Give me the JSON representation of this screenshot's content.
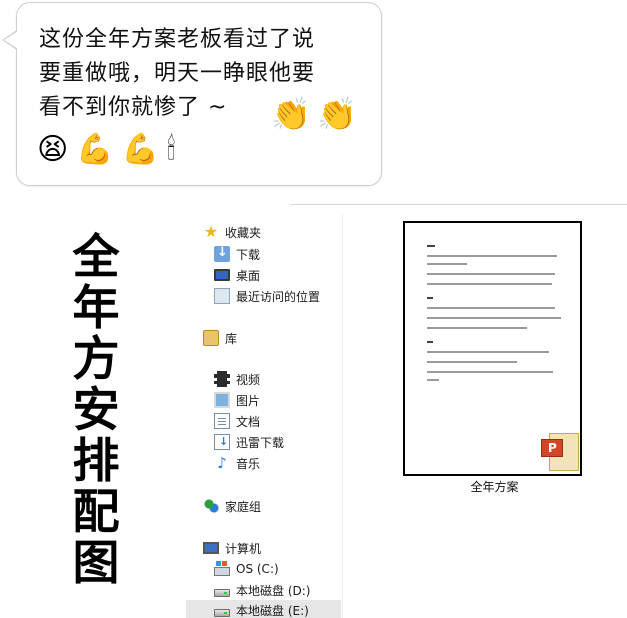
{
  "chat": {
    "line1": "这份全年方案老板看过了说",
    "line2": "要重做哦，明天一睁眼他要",
    "line3": "看不到你就惨了 ~",
    "emojis": {
      "clap1": "👏",
      "clap2": "👏",
      "stressed": "😫",
      "muscle1": "💪",
      "muscle2": "💪",
      "candle": "🕯"
    }
  },
  "vertical_title": [
    "全",
    "年",
    "方",
    "安",
    "排",
    "配",
    "图"
  ],
  "sidebar": {
    "favorites": "收藏夹",
    "downloads": "下载",
    "desktop": "桌面",
    "recent": "最近访问的位置",
    "library": "库",
    "videos": "视频",
    "pictures": "图片",
    "documents": "文档",
    "thunder": "迅雷下载",
    "music": "音乐",
    "homegroup": "家庭组",
    "computer": "计算机",
    "drive_c": "OS (C:)",
    "drive_d": "本地磁盘 (D:)",
    "drive_e": "本地磁盘 (E:)"
  },
  "file": {
    "name": "全年方案"
  }
}
